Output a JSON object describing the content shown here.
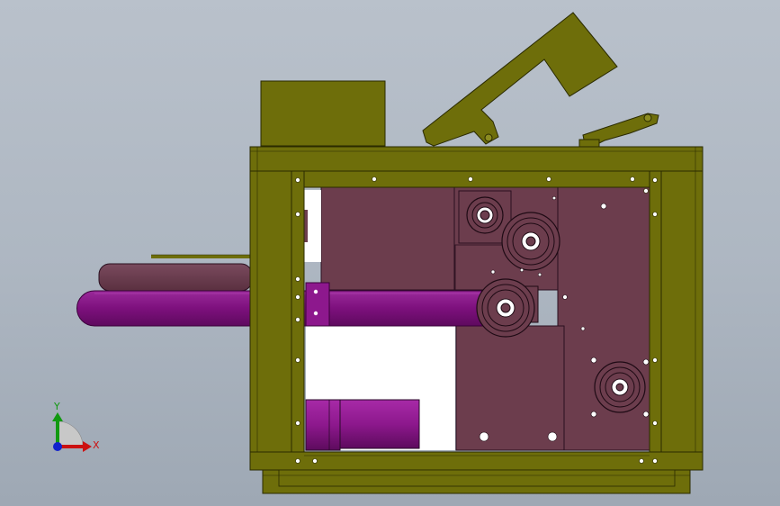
{
  "viewport": {
    "background_top": "#b9c1cb",
    "background_bottom": "#9ea8b4"
  },
  "colors": {
    "frame": "#6e6e0a",
    "frame_edge": "#2a2a00",
    "panel": "#6c3d4d",
    "conveyor": "#8a1a8a",
    "motor": "#8d188d",
    "tray": "#6e3a50"
  },
  "triad": {
    "x_label": "X",
    "y_label": "Y",
    "x_color": "#cc1111",
    "y_color": "#119911",
    "z_color": "#1122cc"
  }
}
